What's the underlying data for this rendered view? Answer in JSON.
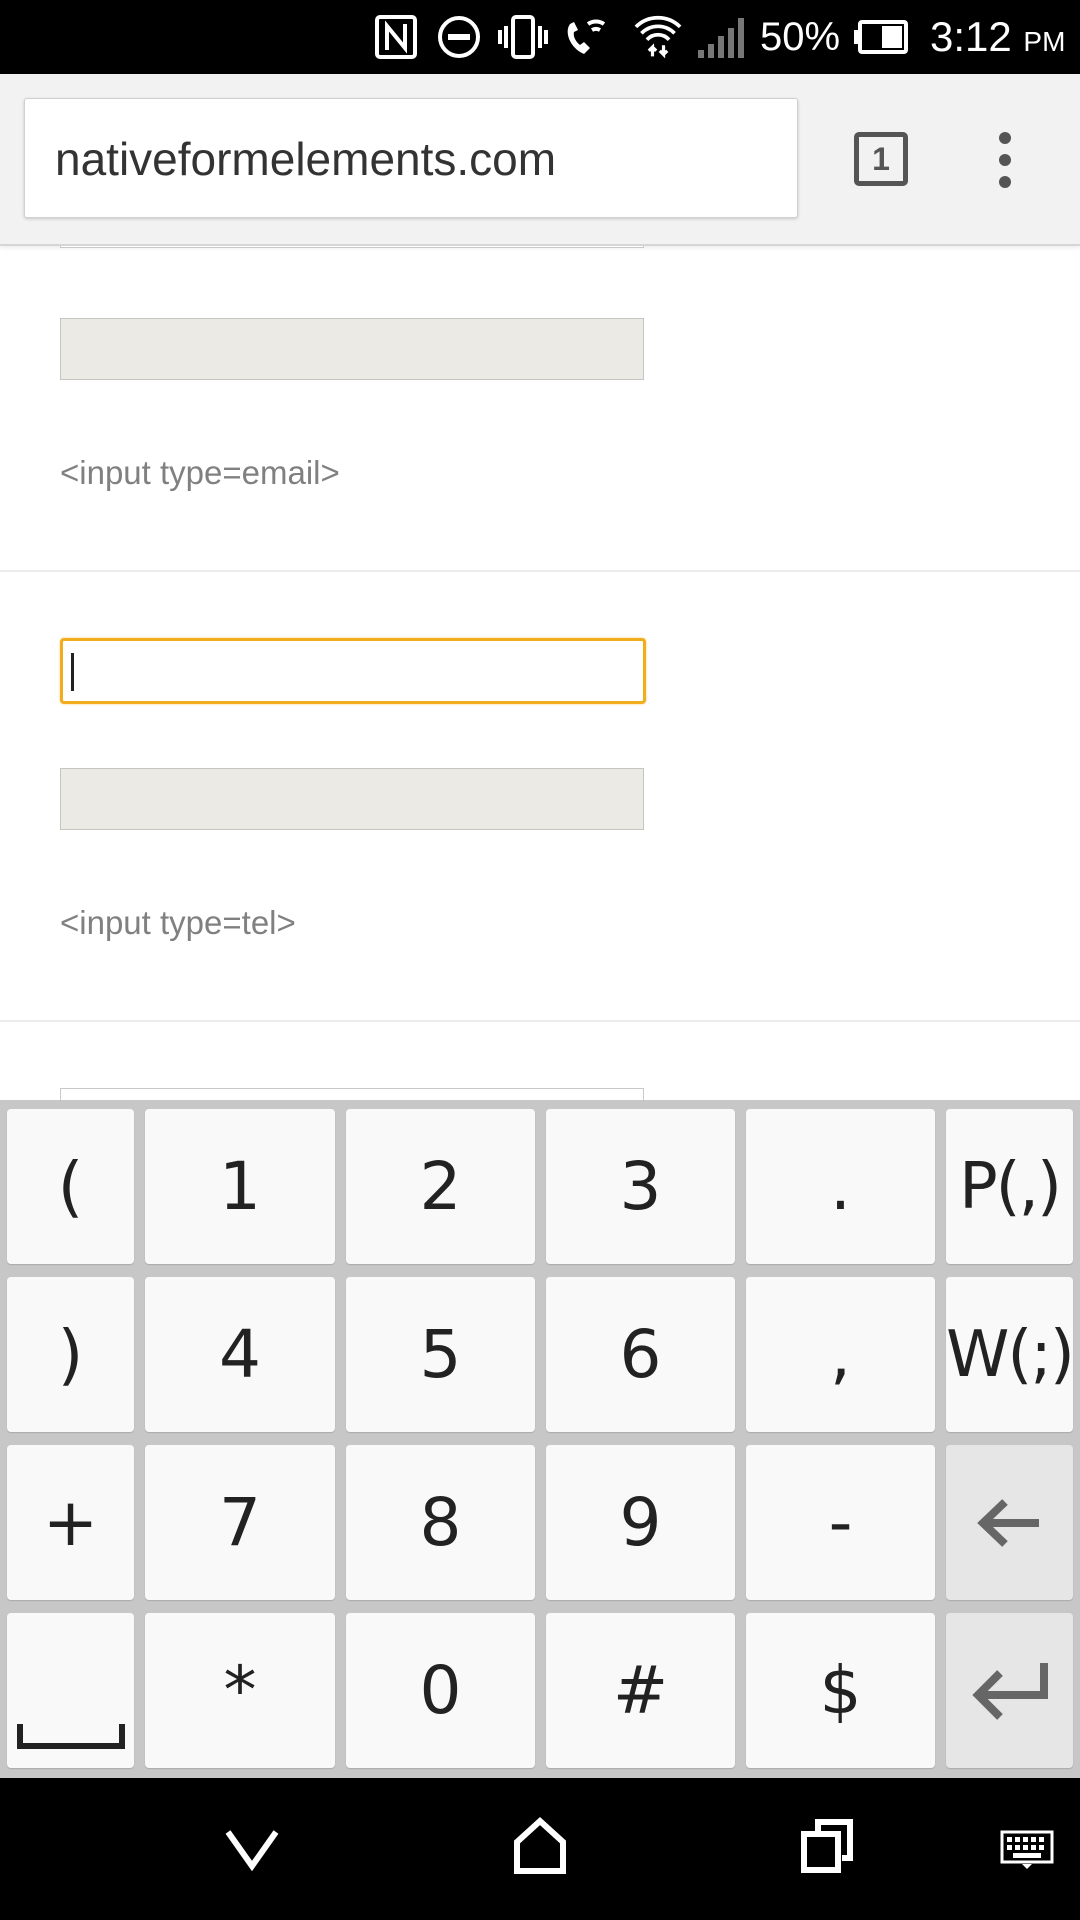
{
  "status_bar": {
    "battery_percent": "50%",
    "time": "3:12",
    "time_suffix": "PM",
    "icons": [
      "nfc-icon",
      "do-not-disturb-icon",
      "vibrate-icon",
      "wifi-calling-icon",
      "wifi-icon",
      "signal-icon",
      "battery-icon"
    ]
  },
  "browser": {
    "url": "nativeformelements.com",
    "tab_count": "1"
  },
  "page": {
    "email_label": "<input type=email>",
    "tel_label": "<input type=tel>"
  },
  "keyboard": {
    "rows": [
      [
        "(",
        "1",
        "2",
        "3",
        ".",
        "P(,)"
      ],
      [
        ")",
        "4",
        "5",
        "6",
        ",",
        "W(;)"
      ],
      [
        "+",
        "7",
        "8",
        "9",
        "-",
        "backspace"
      ],
      [
        "space",
        "*",
        "0",
        "#",
        "$",
        "enter"
      ]
    ],
    "icons": [
      "space-icon",
      "backspace-icon",
      "enter-icon"
    ]
  },
  "nav_bar": {
    "icons": [
      "back-chevron-icon",
      "home-icon",
      "recents-icon",
      "keyboard-icon"
    ]
  }
}
